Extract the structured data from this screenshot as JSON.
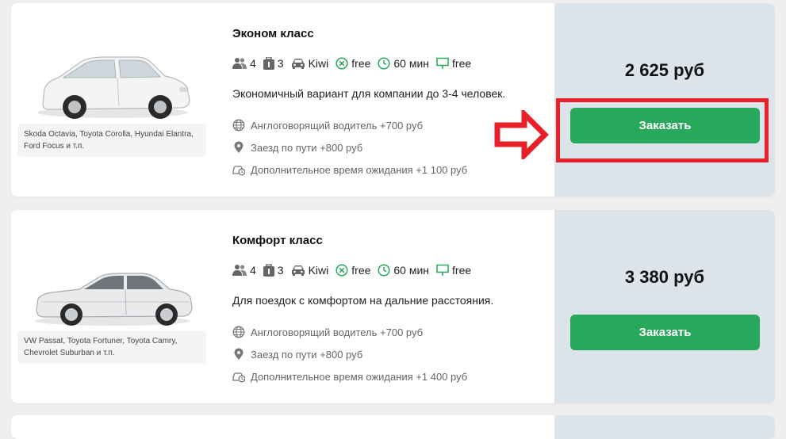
{
  "offers": [
    {
      "title": "Эконом класс",
      "passengers": "4",
      "luggage": "3",
      "car_label": "Kiwi",
      "cancel_label": "free",
      "wait_label": "60 мин",
      "sign_label": "free",
      "description": "Экономичный вариант для компании до 3-4 человек.",
      "models": "Skoda Octavia, Toyota Corolla, Hyundai Elantra, Ford Focus и т.п.",
      "extras": [
        {
          "icon": "globe-icon",
          "text": "Англоговорящий водитель +700 руб"
        },
        {
          "icon": "location-pin-icon",
          "text": "Заезд по пути +800 руб"
        },
        {
          "icon": "waiting-time-icon",
          "text": "Дополнительное время ожидания +1 100 руб"
        }
      ],
      "price": "2 625 руб",
      "order_label": "Заказать"
    },
    {
      "title": "Комфорт класс",
      "passengers": "4",
      "luggage": "3",
      "car_label": "Kiwi",
      "cancel_label": "free",
      "wait_label": "60 мин",
      "sign_label": "free",
      "description": "Для поездок с комфортом на дальние расстояния.",
      "models": "VW Passat, Toyota Fortuner, Toyota Camry, Chevrolet Suburban и т.п.",
      "extras": [
        {
          "icon": "globe-icon",
          "text": "Англоговорящий водитель +700 руб"
        },
        {
          "icon": "location-pin-icon",
          "text": "Заезд по пути +800 руб"
        },
        {
          "icon": "waiting-time-icon",
          "text": "Дополнительное время ожидания +1 400 руб"
        }
      ],
      "price": "3 380 руб",
      "order_label": "Заказать"
    }
  ],
  "colors": {
    "accent_green": "#27a85a",
    "price_panel": "#dce4ea",
    "highlight_red": "#e8202a"
  }
}
